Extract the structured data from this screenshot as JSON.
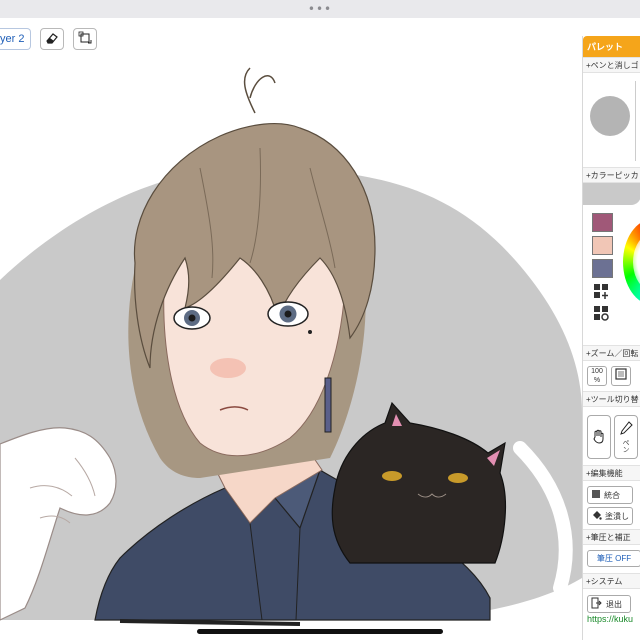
{
  "top_bar": {
    "dots": "•••"
  },
  "toolbar": {
    "layer_label": "yer 2",
    "eraser_icon": "eraser-icon",
    "transform_icon": "transform-icon"
  },
  "canvas": {
    "background_shape_color": "#c9c9c9",
    "line_color": "#222222"
  },
  "palette": {
    "title": "パレット",
    "sections": {
      "pen_eraser": "+ペンと消しゴ",
      "color_picker": "+カラーピッカ",
      "zoom_rotate": "+ズーム／回転",
      "tool_switch": "+ツール切り替",
      "edit_functions": "+編集機能",
      "pressure_correction": "+筆圧と補正",
      "system": "+システム"
    },
    "swatches": [
      "#a05878",
      "#f1c6b6",
      "#6c7193"
    ],
    "zoom": {
      "zoom_label": "100",
      "zoom_unit": "%"
    },
    "tool_pen_label": "ペン",
    "edit": {
      "merge_label": "統合",
      "fill_label": "塗潰し"
    },
    "pressure": {
      "pressure_off_label": "筆圧 OFF"
    },
    "system": {
      "exit_label": "退出"
    },
    "footer_link": "https://kuku"
  }
}
